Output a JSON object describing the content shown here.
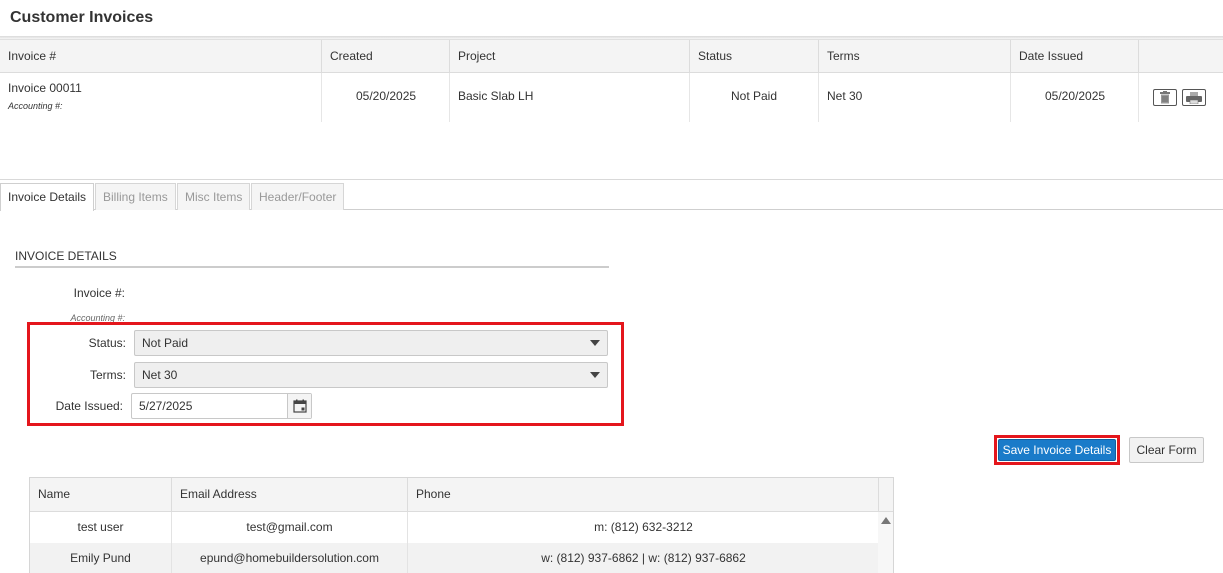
{
  "page": {
    "title": "Customer Invoices"
  },
  "invoices": {
    "columns": [
      "Invoice #",
      "Created",
      "Project",
      "Status",
      "Terms",
      "Date Issued",
      ""
    ],
    "rows": [
      {
        "invoice": "Invoice 00011",
        "accounting": "Accounting #:",
        "created": "05/20/2025",
        "project": "Basic Slab LH",
        "status": "Not Paid",
        "terms": "Net 30",
        "date_issued": "05/20/2025"
      }
    ],
    "actions": {
      "delete_icon": "trash-icon",
      "print_icon": "printer-icon"
    }
  },
  "tabs": [
    {
      "label": "Invoice Details",
      "active": true
    },
    {
      "label": "Billing Items",
      "active": false
    },
    {
      "label": "Misc Items",
      "active": false
    },
    {
      "label": "Header/Footer",
      "active": false
    }
  ],
  "form": {
    "section_title": "INVOICE DETAILS",
    "invoice_label": "Invoice #:",
    "accounting_label": "Accounting #:",
    "status_label": "Status:",
    "status_value": "Not Paid",
    "terms_label": "Terms:",
    "terms_value": "Net 30",
    "date_label": "Date Issued:",
    "date_value": "5/27/2025",
    "calendar_icon": "calendar-icon",
    "save_label": "Save Invoice Details",
    "clear_label": "Clear Form"
  },
  "contacts": {
    "columns": [
      "Name",
      "Email Address",
      "Phone"
    ],
    "rows": [
      {
        "name": "test user",
        "email": "test@gmail.com",
        "phone": "m: (812) 632-3212"
      },
      {
        "name": "Emily Pund",
        "email": "epund@homebuildersolution.com",
        "phone": "w: (812) 937-6862 | w: (812) 937-6862"
      }
    ]
  },
  "colors": {
    "accent": "#1a7bc9",
    "highlight": "#e4161c"
  }
}
